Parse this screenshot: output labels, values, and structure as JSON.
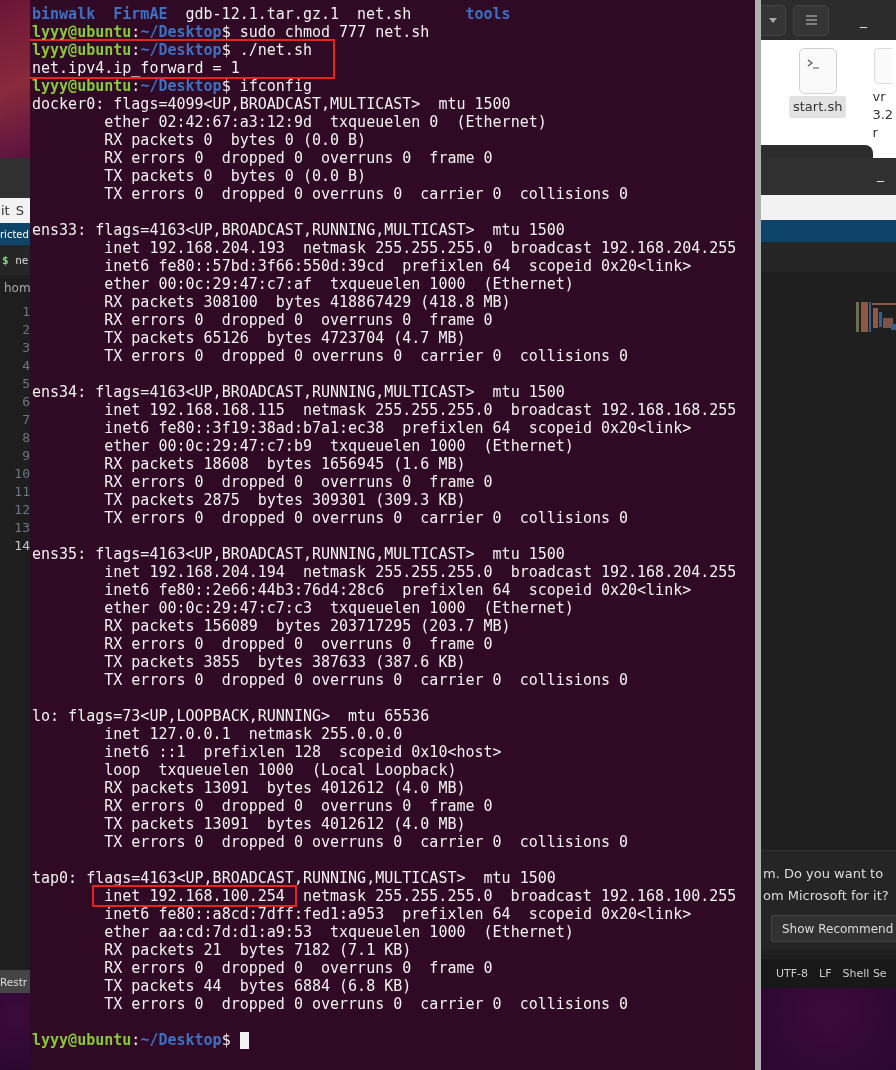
{
  "left_window": {
    "menu_items": [
      "it",
      "S"
    ],
    "banner": "ricted",
    "tab": {
      "symbol": "$",
      "label": "ne"
    },
    "breadcrumb": "hom",
    "line_numbers": [
      {
        "text": "1",
        "selected": false
      },
      {
        "text": "2",
        "selected": false
      },
      {
        "text": "3",
        "selected": false
      },
      {
        "text": "4",
        "selected": false
      },
      {
        "text": "5",
        "selected": false
      },
      {
        "text": "6",
        "selected": false
      },
      {
        "text": "7",
        "selected": false
      },
      {
        "text": "8",
        "selected": false
      },
      {
        "text": "9",
        "selected": false
      },
      {
        "text": "10",
        "selected": false
      },
      {
        "text": "11",
        "selected": false
      },
      {
        "text": "12",
        "selected": false
      },
      {
        "text": "13",
        "selected": false
      },
      {
        "text": "14",
        "selected": true
      }
    ],
    "status": "Restr"
  },
  "file_manager": {
    "minimize": "_",
    "files": [
      {
        "name": "start.sh",
        "selected": true,
        "kind": "script"
      },
      {
        "name": "vr\n3.2\nr",
        "selected": false,
        "kind": "file"
      }
    ]
  },
  "right_window": {
    "minimize": "_",
    "notification": {
      "lines": [
        "m. Do you want to",
        "om Microsoft for it?"
      ],
      "button": "Show Recommend"
    },
    "status_items": [
      "UTF-8",
      "LF",
      "Shell Se"
    ]
  },
  "terminal": {
    "lines": [
      {
        "kind": "listing",
        "entries": [
          {
            "text": "binwalk",
            "kind": "dir"
          },
          {
            "text": "FirmAE",
            "kind": "dir"
          },
          {
            "text": "gdb-12.1.tar.gz.1",
            "kind": "file"
          },
          {
            "text": "net.sh",
            "kind": "file"
          },
          {
            "text": "tools",
            "kind": "dir"
          }
        ]
      },
      {
        "kind": "prompt",
        "user": "lyyy@ubuntu",
        "separator": ":",
        "path": "~/Desktop",
        "symbol": "$",
        "command": "sudo chmod 777 net.sh"
      },
      {
        "kind": "boxed",
        "lines": [
          {
            "kind": "prompt",
            "user": "lyyy@ubuntu",
            "separator": ":",
            "path": "~/Desktop",
            "symbol": "$",
            "command": "./net.sh"
          },
          {
            "kind": "output",
            "text": "net.ipv4.ip_forward = 1"
          }
        ]
      },
      {
        "kind": "prompt",
        "user": "lyyy@ubuntu",
        "separator": ":",
        "path": "~/Desktop",
        "symbol": "$",
        "command": "ifconfig"
      },
      {
        "kind": "output",
        "text": "docker0: flags=4099<UP,BROADCAST,MULTICAST>  mtu 1500"
      },
      {
        "kind": "output",
        "text": "        ether 02:42:67:a3:12:9d  txqueuelen 0  (Ethernet)"
      },
      {
        "kind": "output",
        "text": "        RX packets 0  bytes 0 (0.0 B)"
      },
      {
        "kind": "output",
        "text": "        RX errors 0  dropped 0  overruns 0  frame 0"
      },
      {
        "kind": "output",
        "text": "        TX packets 0  bytes 0 (0.0 B)"
      },
      {
        "kind": "output",
        "text": "        TX errors 0  dropped 0 overruns 0  carrier 0  collisions 0"
      },
      {
        "kind": "blank"
      },
      {
        "kind": "output",
        "text": "ens33: flags=4163<UP,BROADCAST,RUNNING,MULTICAST>  mtu 1500"
      },
      {
        "kind": "output",
        "text": "        inet 192.168.204.193  netmask 255.255.255.0  broadcast 192.168.204.255"
      },
      {
        "kind": "output",
        "text": "        inet6 fe80::57bd:3f66:550d:39cd  prefixlen 64  scopeid 0x20<link>"
      },
      {
        "kind": "output",
        "text": "        ether 00:0c:29:47:c7:af  txqueuelen 1000  (Ethernet)"
      },
      {
        "kind": "output",
        "text": "        RX packets 308100  bytes 418867429 (418.8 MB)"
      },
      {
        "kind": "output",
        "text": "        RX errors 0  dropped 0  overruns 0  frame 0"
      },
      {
        "kind": "output",
        "text": "        TX packets 65126  bytes 4723704 (4.7 MB)"
      },
      {
        "kind": "output",
        "text": "        TX errors 0  dropped 0 overruns 0  carrier 0  collisions 0"
      },
      {
        "kind": "blank"
      },
      {
        "kind": "output",
        "text": "ens34: flags=4163<UP,BROADCAST,RUNNING,MULTICAST>  mtu 1500"
      },
      {
        "kind": "output",
        "text": "        inet 192.168.168.115  netmask 255.255.255.0  broadcast 192.168.168.255"
      },
      {
        "kind": "output",
        "text": "        inet6 fe80::3f19:38ad:b7a1:ec38  prefixlen 64  scopeid 0x20<link>"
      },
      {
        "kind": "output",
        "text": "        ether 00:0c:29:47:c7:b9  txqueuelen 1000  (Ethernet)"
      },
      {
        "kind": "output",
        "text": "        RX packets 18608  bytes 1656945 (1.6 MB)"
      },
      {
        "kind": "output",
        "text": "        RX errors 0  dropped 0  overruns 0  frame 0"
      },
      {
        "kind": "output",
        "text": "        TX packets 2875  bytes 309301 (309.3 KB)"
      },
      {
        "kind": "output",
        "text": "        TX errors 0  dropped 0 overruns 0  carrier 0  collisions 0"
      },
      {
        "kind": "blank"
      },
      {
        "kind": "output",
        "text": "ens35: flags=4163<UP,BROADCAST,RUNNING,MULTICAST>  mtu 1500"
      },
      {
        "kind": "output",
        "text": "        inet 192.168.204.194  netmask 255.255.255.0  broadcast 192.168.204.255"
      },
      {
        "kind": "output",
        "text": "        inet6 fe80::2e66:44b3:76d4:28c6  prefixlen 64  scopeid 0x20<link>"
      },
      {
        "kind": "output",
        "text": "        ether 00:0c:29:47:c7:c3  txqueuelen 1000  (Ethernet)"
      },
      {
        "kind": "output",
        "text": "        RX packets 156089  bytes 203717295 (203.7 MB)"
      },
      {
        "kind": "output",
        "text": "        RX errors 0  dropped 0  overruns 0  frame 0"
      },
      {
        "kind": "output",
        "text": "        TX packets 3855  bytes 387633 (387.6 KB)"
      },
      {
        "kind": "output",
        "text": "        TX errors 0  dropped 0 overruns 0  carrier 0  collisions 0"
      },
      {
        "kind": "blank"
      },
      {
        "kind": "output",
        "text": "lo: flags=73<UP,LOOPBACK,RUNNING>  mtu 65536"
      },
      {
        "kind": "output",
        "text": "        inet 127.0.0.1  netmask 255.0.0.0"
      },
      {
        "kind": "output",
        "text": "        inet6 ::1  prefixlen 128  scopeid 0x10<host>"
      },
      {
        "kind": "output",
        "text": "        loop  txqueuelen 1000  (Local Loopback)"
      },
      {
        "kind": "output",
        "text": "        RX packets 13091  bytes 4012612 (4.0 MB)"
      },
      {
        "kind": "output",
        "text": "        RX errors 0  dropped 0  overruns 0  frame 0"
      },
      {
        "kind": "output",
        "text": "        TX packets 13091  bytes 4012612 (4.0 MB)"
      },
      {
        "kind": "output",
        "text": "        TX errors 0  dropped 0 overruns 0  carrier 0  collisions 0"
      },
      {
        "kind": "blank"
      },
      {
        "kind": "output",
        "text": "tap0: flags=4163<UP,BROADCAST,RUNNING,MULTICAST>  mtu 1500"
      },
      {
        "kind": "marked",
        "marked": "inet 192.168.100.254",
        "after": "netmask 255.255.255.0  broadcast 192.168.100.255"
      },
      {
        "kind": "output",
        "text": "        inet6 fe80::a8cd:7dff:fed1:a953  prefixlen 64  scopeid 0x20<link>"
      },
      {
        "kind": "output",
        "text": "        ether aa:cd:7d:d1:a9:53  txqueuelen 1000  (Ethernet)"
      },
      {
        "kind": "output",
        "text": "        RX packets 21  bytes 7182 (7.1 KB)"
      },
      {
        "kind": "output",
        "text": "        RX errors 0  dropped 0  overruns 0  frame 0"
      },
      {
        "kind": "output",
        "text": "        TX packets 44  bytes 6884 (6.8 KB)"
      },
      {
        "kind": "output",
        "text": "        TX errors 0  dropped 0 overruns 0  carrier 0  collisions 0"
      },
      {
        "kind": "blank"
      },
      {
        "kind": "prompt",
        "user": "lyyy@ubuntu",
        "separator": ":",
        "path": "~/Desktop",
        "symbol": "$",
        "cursor": true
      }
    ]
  }
}
